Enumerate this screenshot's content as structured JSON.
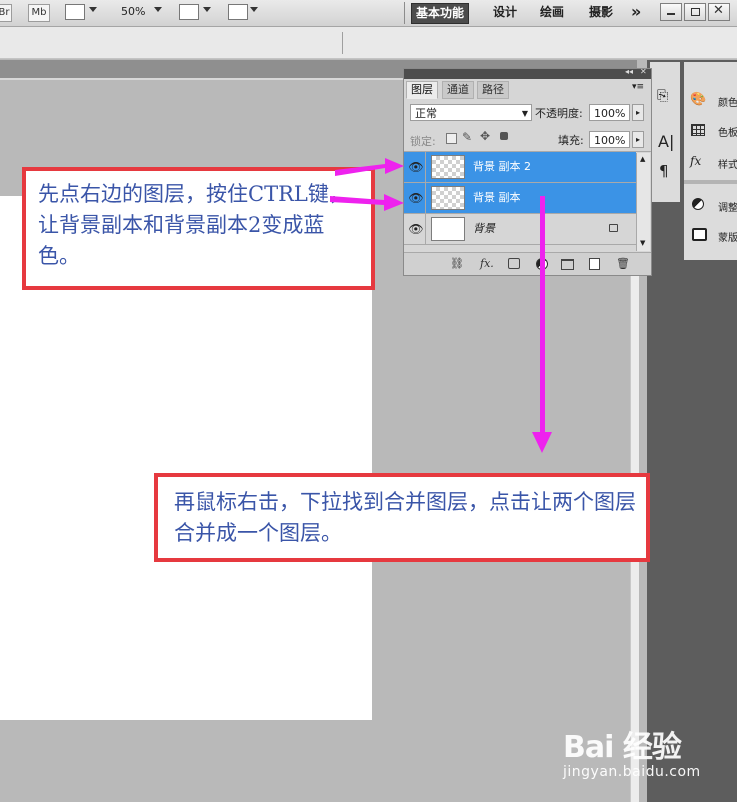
{
  "toolbar": {
    "br_label": "Br",
    "mb_label": "Mb",
    "zoom": "50%",
    "workspaces": [
      "基本功能",
      "设计",
      "绘画",
      "摄影"
    ],
    "more": "»"
  },
  "layers_panel": {
    "tabs": [
      "图层",
      "通道",
      "路径"
    ],
    "blend_mode": "正常",
    "opacity_label": "不透明度:",
    "opacity_value": "100%",
    "lock_label": "锁定:",
    "fill_label": "填充:",
    "fill_value": "100%",
    "layers": [
      {
        "name": "背景 副本 2",
        "selected": true
      },
      {
        "name": "背景 副本",
        "selected": true
      },
      {
        "name": "背景",
        "selected": false,
        "locked": true
      }
    ],
    "bottom_icons": [
      "link-icon",
      "fx-icon",
      "mask-icon",
      "adjustment-icon",
      "group-icon",
      "new-layer-icon",
      "trash-icon"
    ],
    "fx_text": "fx."
  },
  "side_dock": {
    "items": [
      "颜色",
      "色板",
      "样式",
      "调整",
      "蒙版"
    ]
  },
  "notes": {
    "note1": "先点右边的图层，按住CTRL键，让背景副本和背景副本2变成蓝色。",
    "note2": "再鼠标右击，下拉找到合并图层，点击让两个图层合并成一个图层。"
  },
  "watermark": {
    "logo": "Bai 经验",
    "url": "jingyan.baidu.com"
  },
  "colors": {
    "annotation_border": "#e6393f",
    "annotation_text": "#3a55a8",
    "arrow": "#ee22ee",
    "selection": "#3b93e6"
  }
}
